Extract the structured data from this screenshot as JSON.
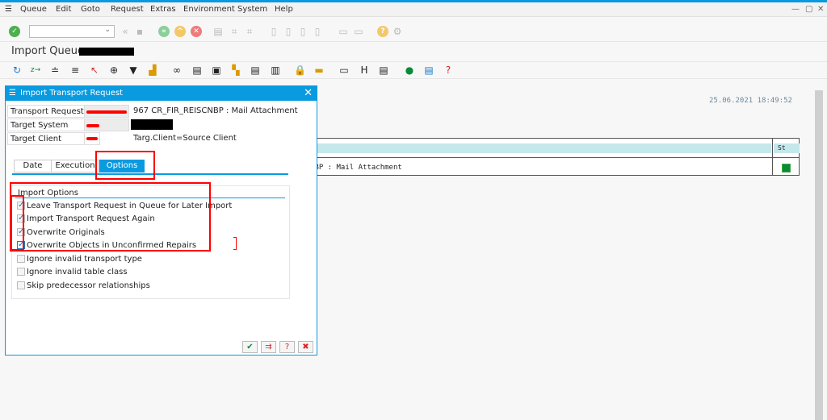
{
  "menu": [
    "Queue",
    "Edit",
    "Goto",
    "Request",
    "Extras",
    "Environment",
    "System",
    "Help"
  ],
  "screen_title": "Import Queue:",
  "timestamp": "25.06.2021 18:49:52",
  "table": {
    "status_header": "St",
    "row_text": "NBP : Mail Attachment",
    "status_color": "#0a8a3a"
  },
  "dialog": {
    "title": "Import Transport Request",
    "fields": [
      {
        "label": "Transport Request",
        "text": "967 CR_FIR_REISCNBP : Mail Attachment"
      },
      {
        "label": "Target System",
        "text": ""
      },
      {
        "label": "Target Client",
        "text": "Targ.Client=Source Client"
      }
    ],
    "tabs": [
      "Date",
      "Execution",
      "Options"
    ],
    "active_tab": "Options",
    "group_title": "Import Options",
    "options": [
      {
        "label": "Leave Transport Request in Queue for Later Import",
        "checked": true
      },
      {
        "label": "Import Transport Request Again",
        "checked": true
      },
      {
        "label": "Overwrite Originals",
        "checked": true
      },
      {
        "label": "Overwrite Objects in Unconfirmed Repairs",
        "checked": true
      },
      {
        "label": "Ignore invalid transport type",
        "checked": false
      },
      {
        "label": "Ignore invalid table class",
        "checked": false
      },
      {
        "label": "Skip predecessor relationships",
        "checked": false
      }
    ],
    "buttons": [
      "continue-icon",
      "import-icon",
      "help-icon",
      "cancel-icon"
    ]
  },
  "colors": {
    "accent": "#0a9ae0",
    "annotation": "#ff0000"
  }
}
